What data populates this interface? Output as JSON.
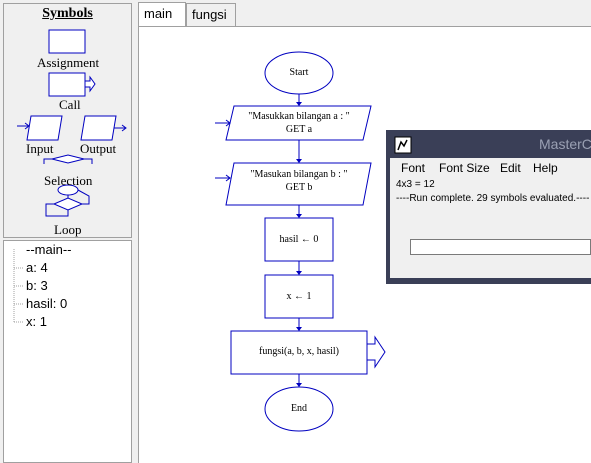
{
  "symbols": {
    "title": "Symbols",
    "items": [
      {
        "label": "Assignment"
      },
      {
        "label": "Call"
      },
      {
        "label": "Input"
      },
      {
        "label": "Output"
      },
      {
        "label": "Selection"
      },
      {
        "label": "Loop"
      }
    ]
  },
  "variables": [
    "--main--",
    "a: 4",
    "b: 3",
    "hasil: 0",
    "x: 1"
  ],
  "tabs": [
    {
      "label": "main",
      "active": true
    },
    {
      "label": "fungsi",
      "active": false
    }
  ],
  "flowchart": {
    "start": "Start",
    "input1_line1": "\"Masukkan bilangan a : \"",
    "input1_line2": "GET a",
    "input2_line1": "\"Masukan bilangan b : \"",
    "input2_line2": "GET b",
    "assign1": "hasil ← 0",
    "assign2": "x ← 1",
    "call": "fungsi(a, b, x, hasil)",
    "end": "End"
  },
  "console": {
    "title": "MasterConsole",
    "menu": [
      "Font",
      "Font Size",
      "Edit",
      "Help"
    ],
    "lines": [
      "4x3 = 12",
      "----Run complete.  29 symbols evaluated.----"
    ],
    "input_value": ""
  },
  "colors": {
    "flow_stroke": "#0000c0",
    "console_frame": "#3a3f57"
  }
}
